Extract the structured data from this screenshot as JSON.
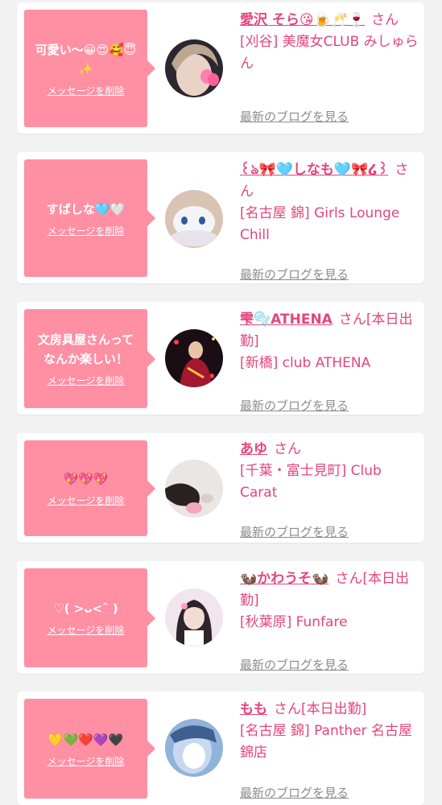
{
  "items": [
    {
      "message": "可愛い〜😀😍🥰😇✨",
      "delete_label": "メッセージを削除",
      "name": "愛沢 そら😘🍺🥂🍷",
      "honorific": "さん",
      "status": "",
      "shop": "[刈谷] 美魔女CLUB みしゅらん",
      "blog_link": "最新のブログを見る",
      "avatar_icon": "avatar-photo"
    },
    {
      "message": "すばしな🩵🤍",
      "delete_label": "メッセージを削除",
      "name": "꒰ঌ🎀🩵しなも🩵🎀໒꒱",
      "honorific": "さん",
      "status": "",
      "shop": "[名古屋 錦] Girls Lounge Chill",
      "blog_link": "最新のブログを見る",
      "avatar_icon": "avatar-photo"
    },
    {
      "message": "文房具屋さんってなんか楽しい！",
      "delete_label": "メッセージを削除",
      "name": "雫🫧ATHENA",
      "honorific": "さん",
      "status": "[本日出勤]",
      "shop": "[新橋] club ATHENA",
      "blog_link": "最新のブログを見る",
      "avatar_icon": "avatar-photo"
    },
    {
      "message": "💖💖💖",
      "delete_label": "メッセージを削除",
      "name": "あゆ",
      "honorific": "さん",
      "status": "",
      "shop": "[千葉・富士見町] Club Carat",
      "blog_link": "最新のブログを見る",
      "avatar_icon": "avatar-photo"
    },
    {
      "message": "♡( >ᴗ<ˆ )",
      "delete_label": "メッセージを削除",
      "name": "🦦かわうそ🦦",
      "honorific": "さん",
      "status": "[本日出勤]",
      "shop": "[秋葉原] Funfare",
      "blog_link": "最新のブログを見る",
      "avatar_icon": "avatar-photo"
    },
    {
      "message": "💛💚❤️💜🖤",
      "delete_label": "メッセージを削除",
      "name": "もも",
      "honorific": "さん",
      "status": "[本日出勤]",
      "shop": "[名古屋 錦] Panther 名古屋錦店",
      "blog_link": "最新のブログを見る",
      "avatar_icon": "avatar-photo"
    }
  ],
  "colors": {
    "bubble": "#ff8fa3",
    "name": "#e5457a",
    "blog_link": "#8c8c8c",
    "background": "#f2f2f2"
  }
}
